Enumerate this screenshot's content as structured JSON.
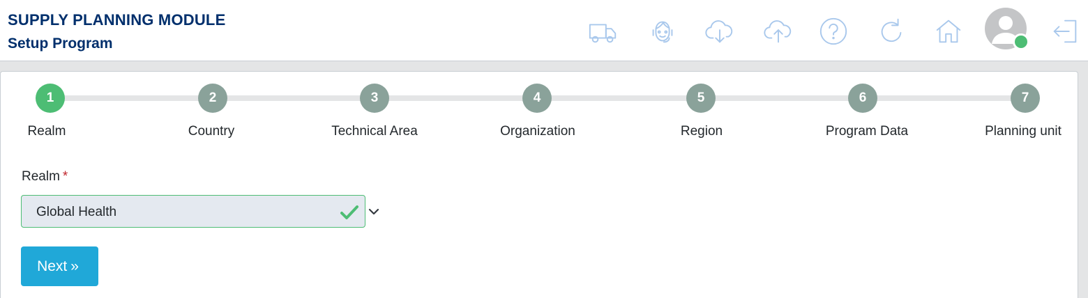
{
  "header": {
    "title": "SUPPLY PLANNING MODULE",
    "subtitle": "Setup Program",
    "icons": [
      "truck-icon",
      "support-agent-icon",
      "cloud-download-icon",
      "cloud-upload-icon",
      "help-icon",
      "refresh-icon",
      "home-icon",
      "avatar",
      "logout-icon"
    ],
    "presence_color": "#4dbd74"
  },
  "stepper": {
    "steps": [
      {
        "number": "1",
        "label": "Realm",
        "active": true
      },
      {
        "number": "2",
        "label": "Country",
        "active": false
      },
      {
        "number": "3",
        "label": "Technical Area",
        "active": false
      },
      {
        "number": "4",
        "label": "Organization",
        "active": false
      },
      {
        "number": "5",
        "label": "Region",
        "active": false
      },
      {
        "number": "6",
        "label": "Program Data",
        "active": false
      },
      {
        "number": "7",
        "label": "Planning unit",
        "active": false
      }
    ],
    "active_color": "#4dbd74",
    "inactive_color": "#8aa29a"
  },
  "form": {
    "realm_label": "Realm",
    "required_marker": "*",
    "realm_value": "Global Health",
    "valid_color": "#4dbd74"
  },
  "actions": {
    "next_label": "Next",
    "next_glyph": "»",
    "next_color": "#20a8d8"
  }
}
